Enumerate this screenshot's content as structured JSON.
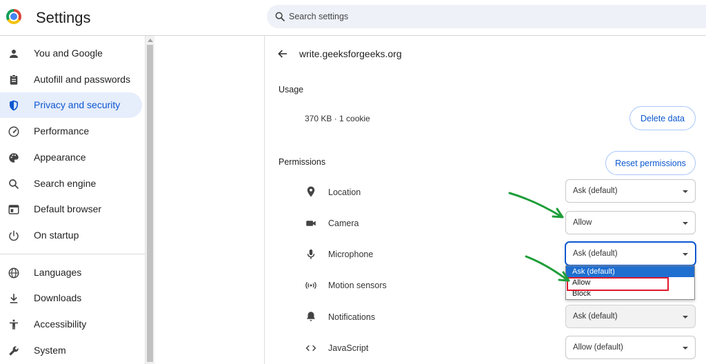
{
  "header": {
    "title": "Settings",
    "search_placeholder": "Search settings"
  },
  "sidebar": {
    "items": [
      {
        "label": "You and Google",
        "icon": "person-icon"
      },
      {
        "label": "Autofill and passwords",
        "icon": "clipboard-icon"
      },
      {
        "label": "Privacy and security",
        "icon": "shield-icon",
        "active": true
      },
      {
        "label": "Performance",
        "icon": "speedometer-icon"
      },
      {
        "label": "Appearance",
        "icon": "palette-icon"
      },
      {
        "label": "Search engine",
        "icon": "search-icon"
      },
      {
        "label": "Default browser",
        "icon": "browser-window-icon"
      },
      {
        "label": "On startup",
        "icon": "power-icon"
      },
      {
        "label": "Languages",
        "icon": "globe-icon"
      },
      {
        "label": "Downloads",
        "icon": "download-icon"
      },
      {
        "label": "Accessibility",
        "icon": "accessibility-icon"
      },
      {
        "label": "System",
        "icon": "wrench-icon"
      }
    ]
  },
  "site": {
    "title": "write.geeksforgeeks.org"
  },
  "usage": {
    "heading": "Usage",
    "summary": "370 KB · 1 cookie",
    "delete_label": "Delete data"
  },
  "permissions": {
    "heading": "Permissions",
    "reset_label": "Reset permissions",
    "rows": [
      {
        "label": "Location",
        "icon": "location-pin-icon",
        "value": "Ask (default)"
      },
      {
        "label": "Camera",
        "icon": "camera-icon",
        "value": "Allow"
      },
      {
        "label": "Microphone",
        "icon": "microphone-icon",
        "value": "Ask (default)"
      },
      {
        "label": "Motion sensors",
        "icon": "motion-sensor-icon",
        "value": ""
      },
      {
        "label": "Notifications",
        "icon": "bell-icon",
        "value": "Ask (default)"
      },
      {
        "label": "JavaScript",
        "icon": "code-icon",
        "value": "Allow (default)"
      }
    ]
  },
  "dropdown": {
    "options": [
      "Ask (default)",
      "Allow",
      "Block"
    ],
    "highlighted": "Ask (default)"
  },
  "colors": {
    "accent": "#0b57d0",
    "active_bg": "#e6edfb",
    "annotation_arrow": "#1e9e3a",
    "annotation_box": "#e0162b"
  }
}
